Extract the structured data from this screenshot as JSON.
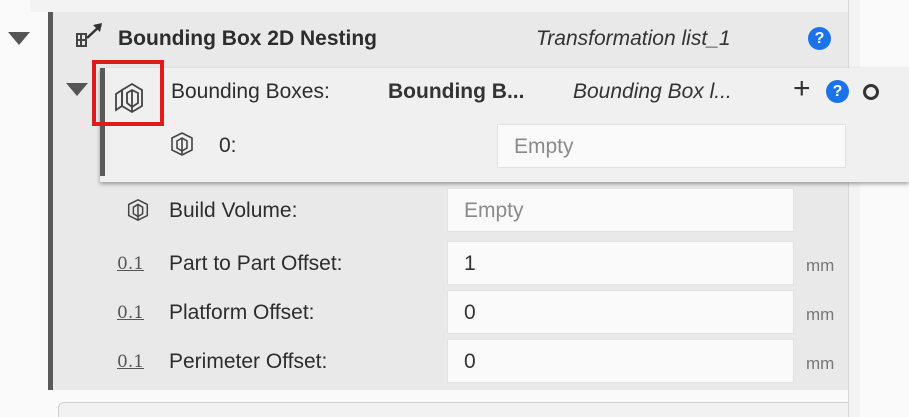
{
  "node": {
    "title": "Bounding Box 2D Nesting",
    "list_name": "Transformation list_1",
    "help": "?"
  },
  "bounding_boxes": {
    "label": "Bounding Boxes:",
    "value": "Bounding B...",
    "type": "Bounding Box l...",
    "add": "+",
    "help": "?",
    "items": [
      {
        "label": "0:",
        "value": "Empty"
      }
    ]
  },
  "params": [
    {
      "icon": "bounding-box-icon",
      "label": "Build Volume:",
      "value": "Empty",
      "unit": ""
    },
    {
      "icon": "0.1",
      "label": "Part to Part Offset:",
      "value": "1",
      "unit": "mm"
    },
    {
      "icon": "0.1",
      "label": "Platform Offset:",
      "value": "0",
      "unit": "mm"
    },
    {
      "icon": "0.1",
      "label": "Perimeter Offset:",
      "value": "0",
      "unit": "mm"
    }
  ],
  "colors": {
    "accent": "#1a73e8",
    "highlight": "#e01b1b",
    "panel": "#e9e9e9"
  }
}
